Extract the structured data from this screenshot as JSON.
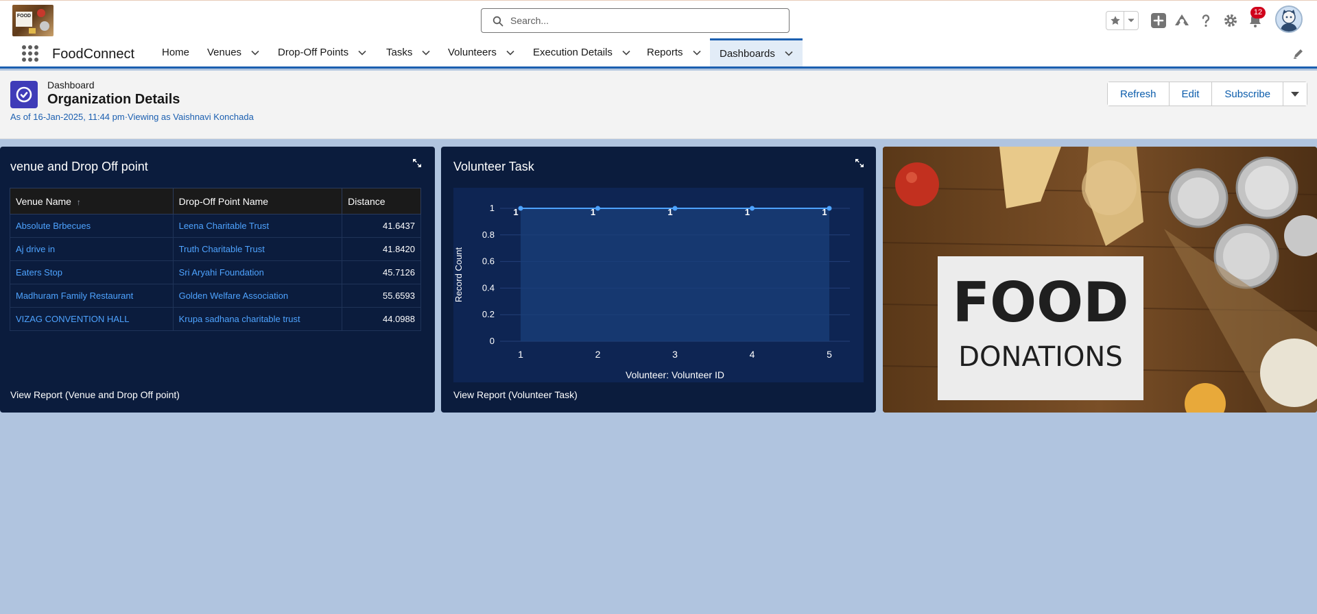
{
  "header": {
    "logo_text": "FOOD",
    "search_placeholder": "Search...",
    "notification_count": "12"
  },
  "nav": {
    "app_name": "FoodConnect",
    "items": [
      {
        "label": "Home"
      },
      {
        "label": "Venues"
      },
      {
        "label": "Drop-Off Points"
      },
      {
        "label": "Tasks"
      },
      {
        "label": "Volunteers"
      },
      {
        "label": "Execution Details"
      },
      {
        "label": "Reports"
      },
      {
        "label": "Dashboards"
      }
    ],
    "active": "Dashboards"
  },
  "page": {
    "type": "Dashboard",
    "title": "Organization Details",
    "subtitle": "As of 16-Jan-2025, 11:44 pm·Viewing as Vaishnavi Konchada",
    "buttons": {
      "refresh": "Refresh",
      "edit": "Edit",
      "subscribe": "Subscribe"
    }
  },
  "venue_widget": {
    "title": "venue and Drop Off point",
    "columns": [
      "Venue Name",
      "Drop-Off Point Name",
      "Distance"
    ],
    "sort_indicator": "↑",
    "rows": [
      {
        "venue": "Absolute Brbecues",
        "dropoff": "Leena Charitable Trust",
        "distance": "41.6437"
      },
      {
        "venue": "Aj drive in",
        "dropoff": "Truth Charitable Trust",
        "distance": "41.8420"
      },
      {
        "venue": "Eaters Stop",
        "dropoff": "Sri Aryahi Foundation",
        "distance": "45.7126"
      },
      {
        "venue": "Madhuram Family Restaurant",
        "dropoff": "Golden Welfare Association",
        "distance": "55.6593"
      },
      {
        "venue": "VIZAG CONVENTION HALL",
        "dropoff": "Krupa sadhana charitable trust",
        "distance": "44.0988"
      }
    ],
    "view_report": "View Report (Venue and Drop Off point)"
  },
  "volunteer_widget": {
    "title": "Volunteer Task",
    "view_report": "View Report (Volunteer Task)"
  },
  "photo_widget": {
    "word1": "FOOD",
    "word2": "DONATIONS"
  },
  "chart_data": {
    "type": "line",
    "title": "Volunteer Task",
    "xlabel": "Volunteer: Volunteer ID",
    "ylabel": "Record Count",
    "categories": [
      "1",
      "2",
      "3",
      "4",
      "5"
    ],
    "series": [
      {
        "values": [
          1,
          1,
          1,
          1,
          1
        ]
      }
    ],
    "yticks": [
      "0",
      "0.2",
      "0.4",
      "0.6",
      "0.8",
      "1"
    ],
    "ylim": [
      0,
      1
    ],
    "data_labels": true,
    "grid": true,
    "line_color": "#4ea3ff"
  },
  "colors": {
    "widget_bg": "#0b1c3d",
    "canvas_bg": "#b0c4df",
    "link": "#4ea3ff",
    "brand": "#1b5fb0"
  }
}
